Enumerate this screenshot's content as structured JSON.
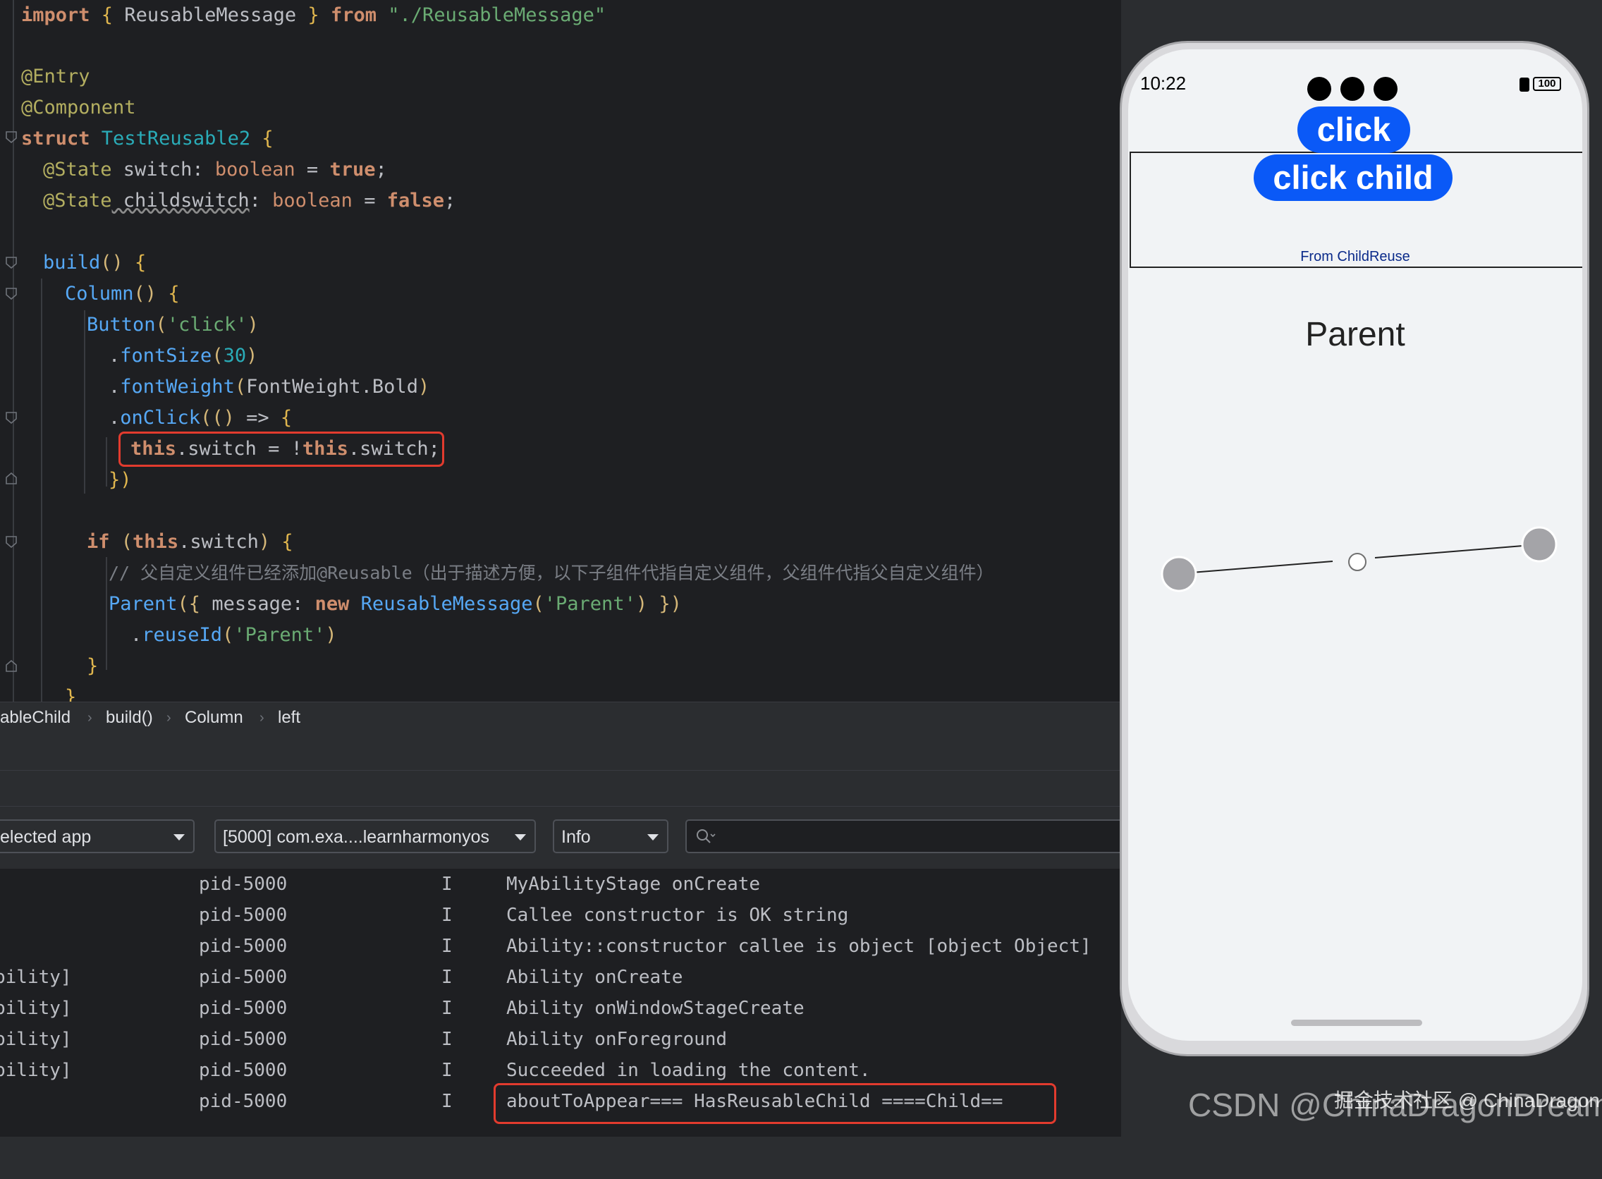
{
  "editor": {
    "line1": {
      "t1": "import",
      "t2": " { ",
      "t3": "ReusableMessage",
      "t4": " } ",
      "t5": "from",
      "t6": " \"./ReusableMessage\""
    },
    "line3": "@Entry",
    "line4": "@Component",
    "line5": {
      "kw": "struct",
      "name": " TestReusable2",
      "brace": " {"
    },
    "line6": {
      "ann": "@State",
      "prop": " switch",
      "colon": ": ",
      "type": "boolean",
      "eq": " = ",
      "val": "true",
      "semi": ";"
    },
    "line7": {
      "ann": "@State",
      "prop": " childswitch",
      "colon": ": ",
      "type": "boolean",
      "eq": " = ",
      "val": "false",
      "semi": ";"
    },
    "line9": {
      "fn": "build",
      "paren": "()",
      "brace": " {"
    },
    "line10": {
      "fn": "Column",
      "paren": "()",
      "brace": " {"
    },
    "line11": {
      "fn": "Button",
      "open": "(",
      "str": "'click'",
      "close": ")"
    },
    "line12": {
      "dot": ".",
      "fn": "fontSize",
      "open": "(",
      "num": "30",
      "close": ")"
    },
    "line13": {
      "dot": ".",
      "fn": "fontWeight",
      "open": "(",
      "cls": "FontWeight",
      "dot2": ".",
      "mem": "Bold",
      "close": ")"
    },
    "line14": {
      "dot": ".",
      "fn": "onClick",
      "open": "((",
      "p2": ")",
      "arrow": " => ",
      "brace": "{"
    },
    "line15": {
      "kw1": "this",
      "p1": ".switch = !",
      "kw2": "this",
      "p2": ".switch;"
    },
    "line16": {
      "close": "})"
    },
    "line18": {
      "kw": "if",
      "sp": " ",
      "open": "(",
      "kw2": "this",
      "p": ".switch",
      "close": ")",
      "brace": " {"
    },
    "line19": "// 父自定义组件已经添加@Reusable（出于描述方便，以下子组件代指自定义组件，父组件代指父自定义组件）",
    "line20": {
      "fn": "Parent",
      "open": "({ ",
      "p": "message: ",
      "kw": "new",
      "cls": " ReusableMessage",
      "o2": "(",
      "str": "'Parent'",
      "c2": ")",
      "close": " })"
    },
    "line21": {
      "dot": ".",
      "fn": "reuseId",
      "open": "(",
      "str": "'Parent'",
      "close": ")"
    },
    "line22": "}",
    "line23": "}"
  },
  "breadcrumb": [
    "ableChild",
    "build()",
    "Column",
    "left"
  ],
  "logcat": {
    "device_filter": "elected app",
    "process_filter": "[5000] com.exa....learnharmonyos",
    "level_filter": "Info",
    "rows": [
      {
        "tag": "",
        "pid": "pid-5000",
        "level": "I",
        "msg": "MyAbilityStage onCreate"
      },
      {
        "tag": "",
        "pid": "pid-5000",
        "level": "I",
        "msg": "Callee constructor is OK string"
      },
      {
        "tag": "",
        "pid": "pid-5000",
        "level": "I",
        "msg": "Ability::constructor callee is object [object Object]"
      },
      {
        "tag": "bility]",
        "pid": "pid-5000",
        "level": "I",
        "msg": "Ability onCreate"
      },
      {
        "tag": "bility]",
        "pid": "pid-5000",
        "level": "I",
        "msg": "Ability onWindowStageCreate"
      },
      {
        "tag": "bility]",
        "pid": "pid-5000",
        "level": "I",
        "msg": "Ability onForeground"
      },
      {
        "tag": "bility]",
        "pid": "pid-5000",
        "level": "I",
        "msg": "Succeeded in loading the content."
      },
      {
        "tag": "",
        "pid": "pid-5000",
        "level": "I",
        "msg": "aboutToAppear=== HasReusableChild ====Child=="
      }
    ]
  },
  "phone": {
    "time": "10:22",
    "battery": "100",
    "button_click": "click",
    "button_click_child": "click child",
    "child_text": "From ChildReuse",
    "parent_text": "Parent",
    "accent": "#0a59f7"
  },
  "watermark": {
    "text": "CSDN @ChinaDragonDreamer",
    "overlay": "掘金技术社区 @ ChinaDragon"
  }
}
